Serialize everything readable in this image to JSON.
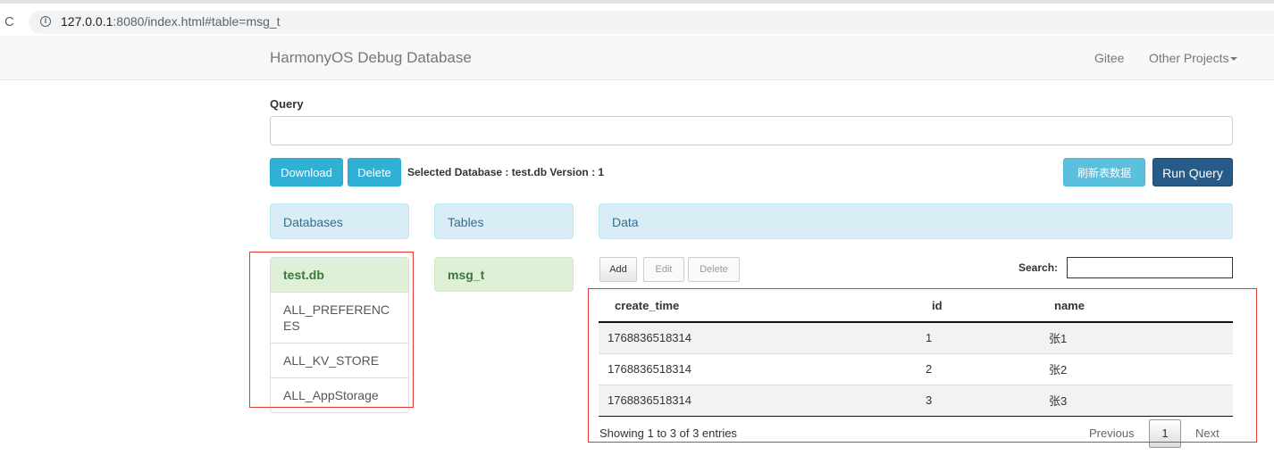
{
  "browser": {
    "reload_glyph": "C",
    "url_host": "127.0.0.1",
    "url_path": ":8080/index.html#table=msg_t"
  },
  "navbar": {
    "brand": "HarmonyOS Debug Database",
    "links": [
      "Gitee",
      "Other Projects"
    ]
  },
  "query": {
    "label": "Query",
    "value": ""
  },
  "actions": {
    "download": "Download",
    "delete": "Delete",
    "selected_db_text": "Selected Database : test.db Version : 1",
    "refresh": "刷新表数据",
    "run_query": "Run Query"
  },
  "panels": {
    "databases": "Databases",
    "tables": "Tables",
    "data": "Data"
  },
  "databases": [
    {
      "name": "test.db",
      "active": true
    },
    {
      "name": "ALL_PREFERENCES",
      "active": false
    },
    {
      "name": "ALL_KV_STORE",
      "active": false
    },
    {
      "name": "ALL_AppStorage",
      "active": false
    }
  ],
  "tables": [
    {
      "name": "msg_t",
      "active": true
    }
  ],
  "data_toolbar": {
    "add": "Add",
    "edit": "Edit",
    "delete": "Delete",
    "search_label": "Search:",
    "search_value": ""
  },
  "table": {
    "columns": [
      "create_time",
      "id",
      "name"
    ],
    "rows": [
      [
        "1768836518314",
        "1",
        "张1"
      ],
      [
        "1768836518314",
        "2",
        "张2"
      ],
      [
        "1768836518314",
        "3",
        "张3"
      ]
    ]
  },
  "pagination": {
    "info": "Showing 1 to 3 of 3 entries",
    "previous": "Previous",
    "page": "1",
    "next": "Next"
  },
  "colors": {
    "info_button": "#31b0d5",
    "primary_button": "#265a88",
    "panel_header_bg": "#d9edf7",
    "active_item_bg": "#dff0d8",
    "highlight_border": "#e53935"
  }
}
